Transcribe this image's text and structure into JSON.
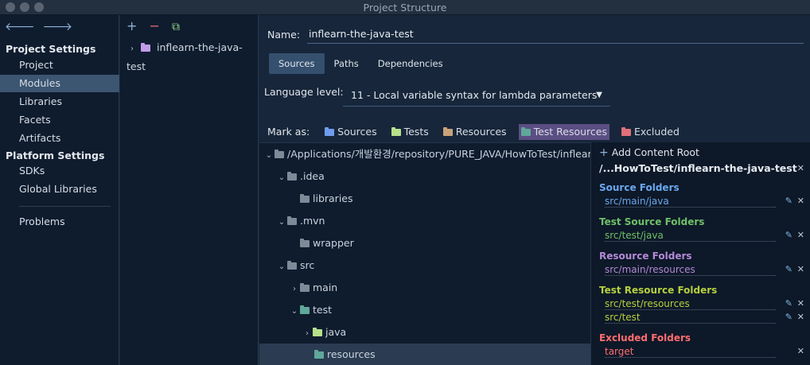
{
  "window": {
    "title": "Project Structure"
  },
  "left_nav": {
    "project_settings_header": "Project Settings",
    "project_items": [
      "Project",
      "Modules",
      "Libraries",
      "Facets",
      "Artifacts"
    ],
    "platform_settings_header": "Platform Settings",
    "platform_items": [
      "SDKs",
      "Global Libraries"
    ],
    "problems": "Problems",
    "selected": "Modules"
  },
  "modules_panel": {
    "toolbar": {
      "add": "+",
      "remove": "−",
      "copy": "⧉"
    },
    "module_name": "inflearn-the-java-test"
  },
  "module_editor": {
    "name_label": "Name:",
    "name_value": "inflearn-the-java-test",
    "tabs": [
      "Sources",
      "Paths",
      "Dependencies"
    ],
    "active_tab": "Sources",
    "language_level_label": "Language level:",
    "language_level_value": "11 - Local variable syntax for lambda parameters",
    "mark_as_label": "Mark as:",
    "mark_as": [
      {
        "label": "Sources",
        "color": "#6f9cf0"
      },
      {
        "label": "Tests",
        "color": "#b6e08a"
      },
      {
        "label": "Resources",
        "color": "#c8a27a"
      },
      {
        "label": "Test Resources",
        "color": "#5fa89a"
      },
      {
        "label": "Excluded",
        "color": "#e0707a"
      }
    ],
    "tree": [
      {
        "label": "/Applications/개발환경/repository/PURE_JAVA/HowToTest/inflearn-the-java-test",
        "expanded": true
      },
      {
        "label": ".idea",
        "expanded": true
      },
      {
        "label": "libraries"
      },
      {
        "label": ".mvn",
        "expanded": true
      },
      {
        "label": "wrapper"
      },
      {
        "label": "src",
        "expanded": true
      },
      {
        "label": "main",
        "expanded": false
      },
      {
        "label": "test",
        "expanded": true
      },
      {
        "label": "java",
        "expanded": false
      },
      {
        "label": "resources",
        "selected": true
      }
    ]
  },
  "content_roots": {
    "add_label": "Add Content Root",
    "root_path": "/...HowToTest/inflearn-the-java-test",
    "groups": [
      {
        "title": "Source Folders",
        "color": "#6aa8f0",
        "paths": [
          "src/main/java"
        ]
      },
      {
        "title": "Test Source Folders",
        "color": "#6fc068",
        "paths": [
          "src/test/java"
        ]
      },
      {
        "title": "Resource Folders",
        "color": "#b48ad6",
        "paths": [
          "src/main/resources"
        ]
      },
      {
        "title": "Test Resource Folders",
        "color": "#b6d040",
        "paths": [
          "src/test/resources",
          "src/test"
        ]
      },
      {
        "title": "Excluded Folders",
        "color": "#ff6e6e",
        "paths": [
          "target"
        ]
      }
    ]
  },
  "colors": {
    "folder_plain": "#7e8a98",
    "folder_test": "#5fa89a",
    "folder_tests_green": "#b6e08a",
    "module_folder": "#c39be8"
  }
}
